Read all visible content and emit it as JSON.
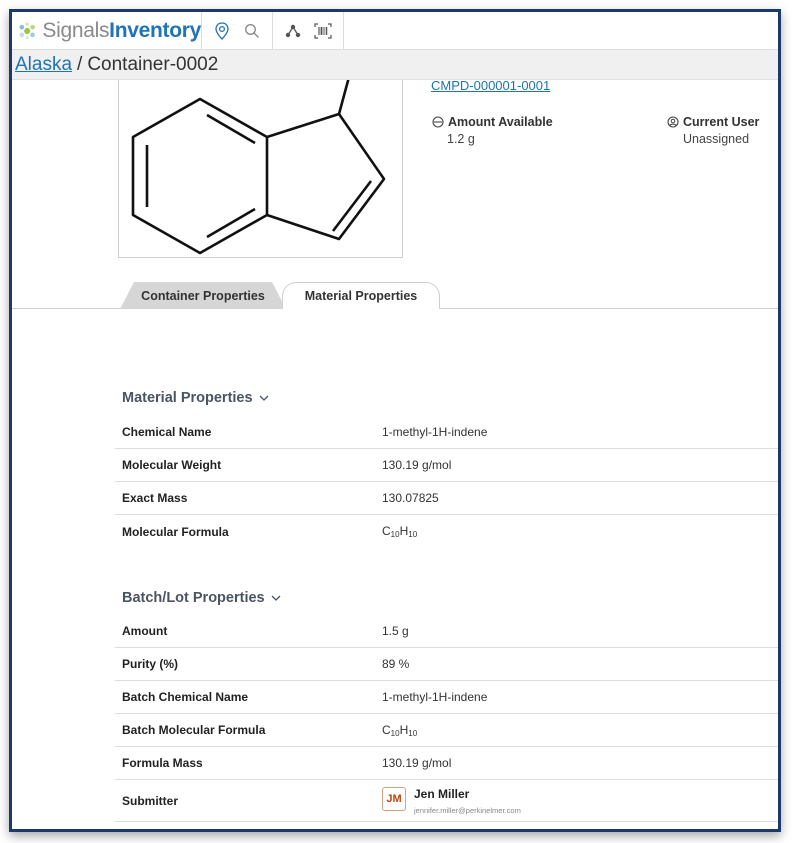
{
  "app": {
    "brand_part1": "Signals",
    "brand_part2": "Inventory"
  },
  "toolbar": {
    "icons": [
      "location-icon",
      "search-icon",
      "structure-search-icon",
      "barcode-icon"
    ]
  },
  "breadcrumb": {
    "parent": "Alaska",
    "separator": "/",
    "current": "Container-0002"
  },
  "compound": {
    "link": "CMPD-000001-0001"
  },
  "summary": {
    "amount_label": "Amount Available",
    "amount_value": "1.2 g",
    "user_label": "Current User",
    "user_value": "Unassigned"
  },
  "tabs": [
    {
      "label": "Container Properties",
      "active": false
    },
    {
      "label": "Material Properties",
      "active": true
    }
  ],
  "material_section": {
    "title": "Material Properties",
    "rows": [
      {
        "label": "Chemical Name",
        "value": "1-methyl-1H-indene"
      },
      {
        "label": "Molecular Weight",
        "value": "130.19 g/mol"
      },
      {
        "label": "Exact Mass",
        "value": "130.07825"
      },
      {
        "label": "Molecular Formula",
        "value": "C10H10"
      }
    ]
  },
  "batch_section": {
    "title": "Batch/Lot Properties",
    "rows": [
      {
        "label": "Amount",
        "value": "1.5 g"
      },
      {
        "label": "Purity (%)",
        "value": "89 %"
      },
      {
        "label": "Batch Chemical Name",
        "value": "1-methyl-1H-indene"
      },
      {
        "label": "Batch Molecular Formula",
        "value": "C10H10"
      },
      {
        "label": "Formula Mass",
        "value": "130.19 g/mol"
      },
      {
        "label": "Submitter",
        "value": ""
      }
    ],
    "submitter": {
      "initials": "JM",
      "name": "Jen Miller",
      "email": "jennifer.miller@perkinelmer.com"
    }
  },
  "colors": {
    "brand_blue": "#1f73b7",
    "frame_border": "#1b3a6b",
    "avatar_text": "#c1440e"
  }
}
